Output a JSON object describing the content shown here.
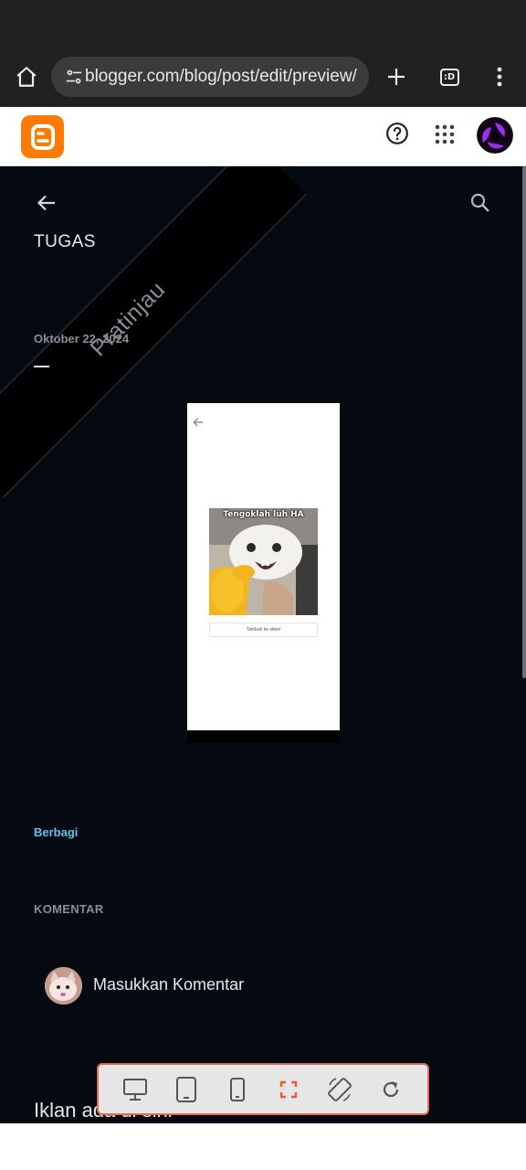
{
  "browser": {
    "url": "blogger.com/blog/post/edit/preview/",
    "tabs_label": ":D"
  },
  "preview": {
    "ribbon_label": "Pratinjau",
    "blog_title": "TUGAS",
    "post_date": "Oktober 22, 2024",
    "sticker_caption": "Tengoklah luh HA",
    "add_sticker_label": "Tambah ke stiker",
    "share_label": "Berbagi",
    "comments_heading": "KOMENTAR",
    "comment_placeholder": "Masukkan Komentar",
    "ad_text": "Iklan ada di sini"
  },
  "colors": {
    "blogger_orange": "#ff7a00",
    "preview_bg": "#050a12",
    "link": "#5fc3e8",
    "toolbar_border": "#e06a53",
    "fullscreen_active": "#f05a28"
  },
  "icons": {
    "home": "home-icon",
    "site_settings": "tune-icon",
    "new_tab": "plus-icon",
    "menu": "more-vert-icon",
    "help": "help-circle-icon",
    "apps": "apps-grid-icon",
    "back": "arrow-left-icon",
    "search": "search-icon",
    "desktop": "desktop-icon",
    "tablet": "tablet-icon",
    "mobile": "mobile-icon",
    "fullscreen": "fullscreen-icon",
    "rotate": "rotate-icon",
    "refresh": "refresh-icon"
  }
}
